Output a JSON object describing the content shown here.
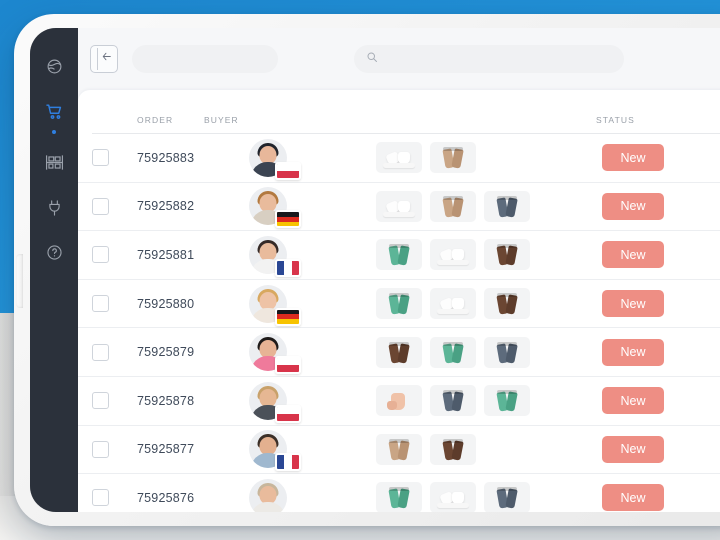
{
  "theme": {
    "background_blue": "#2394da",
    "sidebar_bg": "#2b313b",
    "accent_blue": "#2f7fe0",
    "badge_new_bg": "#ee8e84",
    "card_bg": "#ffffff",
    "screen_bg": "#f6f7f9"
  },
  "sidebar": {
    "items": [
      {
        "name": "globe-icon",
        "label": "Marketplace",
        "active": false
      },
      {
        "name": "cart-icon",
        "label": "Orders",
        "active": true
      },
      {
        "name": "warehouse-icon",
        "label": "Inventory",
        "active": false
      },
      {
        "name": "plug-icon",
        "label": "Integrations",
        "active": false
      },
      {
        "name": "help-icon",
        "label": "Help",
        "active": false
      }
    ]
  },
  "topbar": {
    "back_button_label": "Back",
    "breadcrumb_placeholder": "",
    "search": {
      "value": "",
      "placeholder": "",
      "icon": "search-icon"
    }
  },
  "table": {
    "columns": [
      "ORDER",
      "BUYER",
      "STATUS"
    ],
    "rows": [
      {
        "order": "75925883",
        "checked": false,
        "buyer": {
          "avatar": "woman-dark-hair",
          "country": "Poland",
          "flag": "pl"
        },
        "items": [
          "white-mug-set",
          "tan-tumblers"
        ],
        "status": "New"
      },
      {
        "order": "75925882",
        "checked": false,
        "buyer": {
          "avatar": "man-blond",
          "country": "Germany",
          "flag": "de"
        },
        "items": [
          "white-mug-set",
          "tan-tumblers",
          "slate-tumblers"
        ],
        "status": "New"
      },
      {
        "order": "75925881",
        "checked": false,
        "buyer": {
          "avatar": "woman-brunette",
          "country": "France",
          "flag": "fr"
        },
        "items": [
          "green-tumblers",
          "white-mug-set",
          "brown-tumblers"
        ],
        "status": "New"
      },
      {
        "order": "75925880",
        "checked": false,
        "buyer": {
          "avatar": "woman-blonde",
          "country": "Germany",
          "flag": "de"
        },
        "items": [
          "green-tumblers",
          "white-mug-set",
          "brown-tumblers"
        ],
        "status": "New"
      },
      {
        "order": "75925879",
        "checked": false,
        "buyer": {
          "avatar": "woman-pink-top",
          "country": "Poland",
          "flag": "pl"
        },
        "items": [
          "brown-tumblers",
          "green-tumblers",
          "slate-tumblers"
        ],
        "status": "New"
      },
      {
        "order": "75925878",
        "checked": false,
        "buyer": {
          "avatar": "man-beard",
          "country": "Poland",
          "flag": "pl"
        },
        "items": [
          "peach-jug-set",
          "slate-tumblers",
          "green-tumblers"
        ],
        "status": "New"
      },
      {
        "order": "75925877",
        "checked": false,
        "buyer": {
          "avatar": "man-blue-shirt",
          "country": "France",
          "flag": "fr"
        },
        "items": [
          "tan-tumblers",
          "brown-tumblers"
        ],
        "status": "New"
      },
      {
        "order": "75925876",
        "checked": false,
        "buyer": {
          "avatar": "man-glasses",
          "country": "",
          "flag": ""
        },
        "items": [
          "green-tumblers",
          "white-mug-set",
          "slate-tumblers"
        ],
        "status": "New"
      }
    ]
  }
}
